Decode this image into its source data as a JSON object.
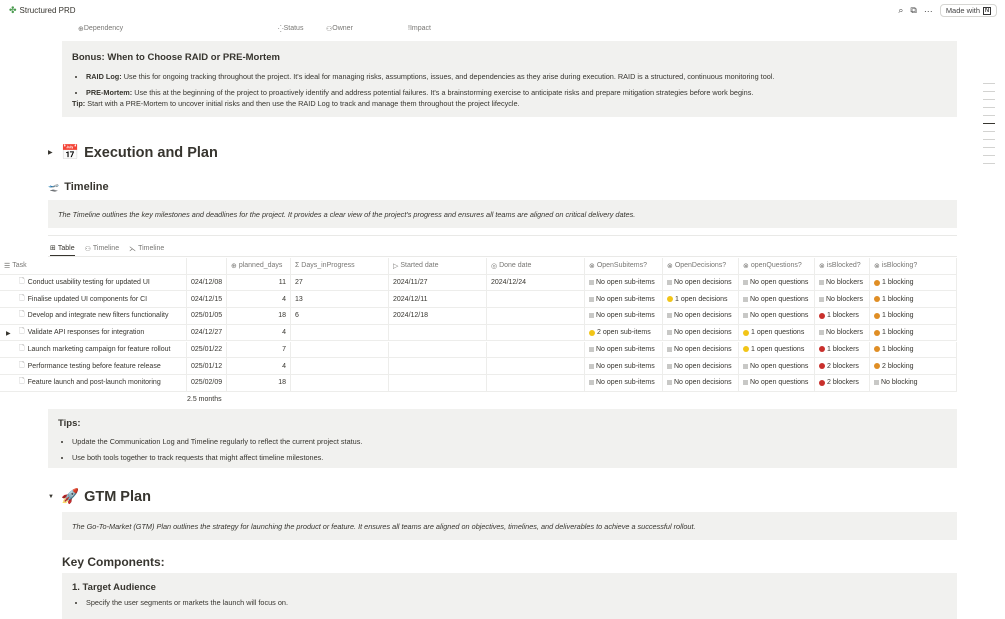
{
  "topbar": {
    "title": "Structured PRD",
    "made_with": "Made with"
  },
  "prev_headers": [
    "Dependency",
    "Status",
    "Owner",
    "Impact"
  ],
  "bonus": {
    "heading": "Bonus: When to Choose RAID or PRE-Mortem",
    "items": [
      {
        "bold": "RAID Log:",
        "text": " Use this for ongoing tracking throughout the project. It's ideal for managing risks, assumptions, issues, and dependencies as they arise during execution. RAID is a structured, continuous monitoring tool."
      },
      {
        "bold": "PRE-Mortem:",
        "text": " Use this at the beginning of the project to proactively identify and address potential failures. It's a brainstorming exercise to anticipate risks and prepare mitigation strategies before work begins."
      }
    ],
    "tip_bold": "Tip:",
    "tip_text": " Start with a PRE-Mortem to uncover initial risks and then use the RAID Log to track and manage them throughout the project lifecycle."
  },
  "execution": {
    "emoji": "📅",
    "heading": "Execution and Plan"
  },
  "timeline": {
    "emoji": "🛫",
    "heading": "Timeline",
    "description": "The Timeline outlines the key milestones and deadlines for the project. It provides a clear view of the project's progress and ensures all teams are aligned on critical delivery dates."
  },
  "view_tabs": [
    "Table",
    "Timeline",
    "Timeline"
  ],
  "table": {
    "headers": [
      "Task",
      "",
      "planned_days",
      "Days_inProgress",
      "Started date",
      "Done date",
      "OpenSubitems?",
      "OpenDecisions?",
      "openQuestions?",
      "isBlocked?",
      "isBlocking?"
    ],
    "rows": [
      {
        "task": "Conduct usability testing for updated UI",
        "date": "024/12/08",
        "planned": "11",
        "inprog": "27",
        "started": "2024/11/27",
        "done": "2024/12/24",
        "sub": "No open sub-items",
        "sub_c": "",
        "dec": "No open decisions",
        "dec_c": "",
        "q": "No open questions",
        "q_c": "",
        "blocked": "No blockers",
        "blocked_c": "",
        "blocking": "1  blocking",
        "blocking_c": "#e08e25"
      },
      {
        "task": "Finalise updated UI components for CI",
        "date": "024/12/15",
        "planned": "4",
        "inprog": "13",
        "started": "2024/12/11",
        "done": "",
        "sub": "No open sub-items",
        "sub_c": "",
        "dec": "1 open decisions",
        "dec_c": "#f2c518",
        "q": "No open questions",
        "q_c": "",
        "blocked": "No blockers",
        "blocked_c": "",
        "blocking": "1  blocking",
        "blocking_c": "#e08e25"
      },
      {
        "task": "Develop and integrate new filters functionality",
        "date": "025/01/05",
        "planned": "18",
        "inprog": "6",
        "started": "2024/12/18",
        "done": "",
        "sub": "No open sub-items",
        "sub_c": "",
        "dec": "No open decisions",
        "dec_c": "",
        "q": "No open questions",
        "q_c": "",
        "blocked": "1  blockers",
        "blocked_c": "#c9302c",
        "blocking": "1  blocking",
        "blocking_c": "#e08e25"
      },
      {
        "task": "Validate API responses for integration",
        "date": "024/12/27",
        "planned": "4",
        "inprog": "",
        "started": "",
        "done": "",
        "sub": "2 open sub-items",
        "sub_c": "#f2c518",
        "dec": "No open decisions",
        "dec_c": "",
        "q": "1 open questions",
        "q_c": "#f2c518",
        "blocked": "No blockers",
        "blocked_c": "",
        "blocking": "1  blocking",
        "blocking_c": "#e08e25",
        "expand": "▶"
      },
      {
        "task": "Launch marketing campaign for feature rollout",
        "date": "025/01/22",
        "planned": "7",
        "inprog": "",
        "started": "",
        "done": "",
        "sub": "No open sub-items",
        "sub_c": "",
        "dec": "No open decisions",
        "dec_c": "",
        "q": "1 open questions",
        "q_c": "#f2c518",
        "blocked": "1  blockers",
        "blocked_c": "#c9302c",
        "blocking": "1  blocking",
        "blocking_c": "#e08e25"
      },
      {
        "task": "Performance testing before feature release",
        "date": "025/01/12",
        "planned": "4",
        "inprog": "",
        "started": "",
        "done": "",
        "sub": "No open sub-items",
        "sub_c": "",
        "dec": "No open decisions",
        "dec_c": "",
        "q": "No open questions",
        "q_c": "",
        "blocked": "2  blockers",
        "blocked_c": "#c9302c",
        "blocking": "2  blocking",
        "blocking_c": "#e08e25"
      },
      {
        "task": "Feature launch and post-launch monitoring",
        "date": "025/02/09",
        "planned": "18",
        "inprog": "",
        "started": "",
        "done": "",
        "sub": "No open sub-items",
        "sub_c": "",
        "dec": "No open decisions",
        "dec_c": "",
        "q": "No open questions",
        "q_c": "",
        "blocked": "2  blockers",
        "blocked_c": "#c9302c",
        "blocking": "No blocking",
        "blocking_c": ""
      }
    ],
    "footer": "2.5 months"
  },
  "tips": {
    "heading": "Tips:",
    "items": [
      "Update the Communication Log and Timeline regularly to reflect the current project status.",
      "Use both tools together to track requests that might affect timeline milestones."
    ]
  },
  "gtm": {
    "emoji": "🚀",
    "heading": "GTM Plan",
    "description": "The Go-To-Market (GTM) Plan outlines the strategy for launching the product or feature. It ensures all teams are aligned on objectives, timelines, and deliverables to achieve a successful rollout."
  },
  "key_components": "Key Components:",
  "target": {
    "heading": "1. Target Audience",
    "item": "Specify the user segments or markets the launch will focus on."
  }
}
